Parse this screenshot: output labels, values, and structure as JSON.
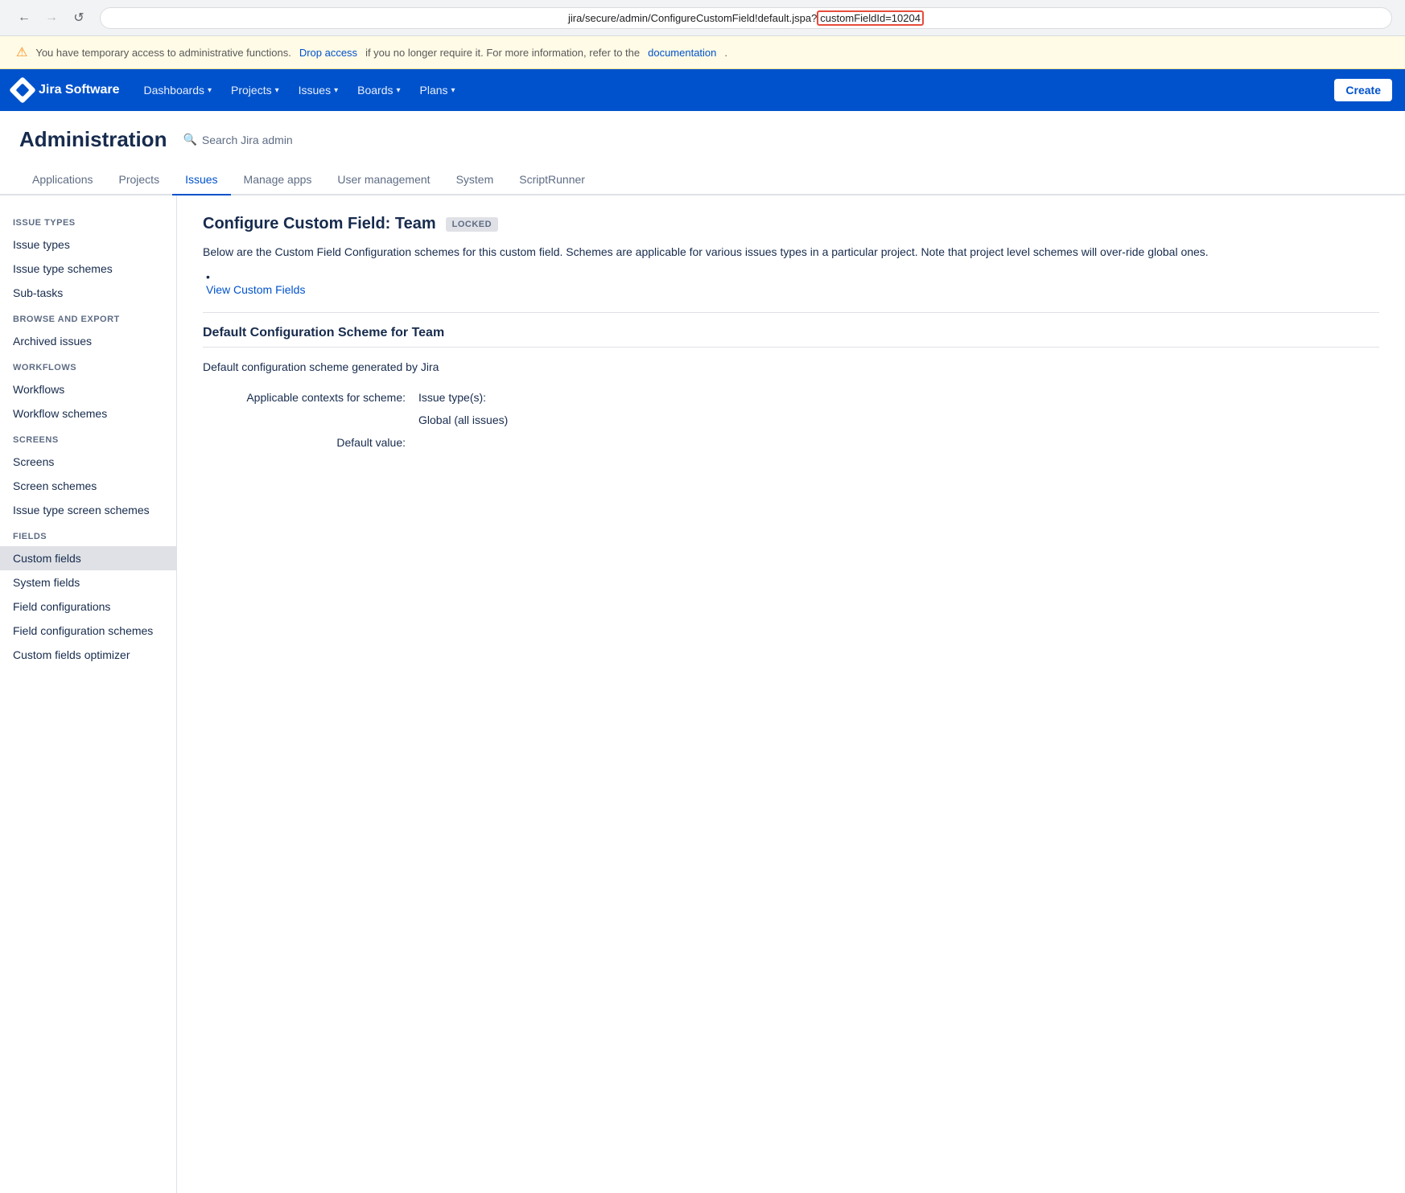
{
  "browser": {
    "back_btn": "←",
    "forward_btn": "→",
    "refresh_btn": "↺",
    "url_prefix": "jira/secure/admin/ConfigureCustomField!default.jspa?",
    "url_highlight": "customFieldId=10204"
  },
  "warning_banner": {
    "icon": "⚠",
    "text_before": "You have temporary access to administrative functions.",
    "drop_access_label": "Drop access",
    "text_middle": " if you no longer require it. For more information, refer to the",
    "documentation_label": "documentation",
    "text_end": "."
  },
  "top_nav": {
    "logo_text": "Jira Software",
    "items": [
      {
        "label": "Dashboards",
        "has_chevron": true
      },
      {
        "label": "Projects",
        "has_chevron": true
      },
      {
        "label": "Issues",
        "has_chevron": true
      },
      {
        "label": "Boards",
        "has_chevron": true
      },
      {
        "label": "Plans",
        "has_chevron": true
      }
    ],
    "create_label": "Create"
  },
  "admin": {
    "title": "Administration",
    "search_placeholder": "Search Jira admin",
    "tabs": [
      {
        "label": "Applications",
        "active": false
      },
      {
        "label": "Projects",
        "active": false
      },
      {
        "label": "Issues",
        "active": true
      },
      {
        "label": "Manage apps",
        "active": false
      },
      {
        "label": "User management",
        "active": false
      },
      {
        "label": "System",
        "active": false
      },
      {
        "label": "ScriptRunner",
        "active": false
      }
    ]
  },
  "sidebar": {
    "sections": [
      {
        "label": "ISSUE TYPES",
        "items": [
          {
            "label": "Issue types",
            "active": false
          },
          {
            "label": "Issue type schemes",
            "active": false
          },
          {
            "label": "Sub-tasks",
            "active": false
          }
        ]
      },
      {
        "label": "BROWSE AND EXPORT",
        "items": [
          {
            "label": "Archived issues",
            "active": false
          }
        ]
      },
      {
        "label": "WORKFLOWS",
        "items": [
          {
            "label": "Workflows",
            "active": false
          },
          {
            "label": "Workflow schemes",
            "active": false
          }
        ]
      },
      {
        "label": "SCREENS",
        "items": [
          {
            "label": "Screens",
            "active": false
          },
          {
            "label": "Screen schemes",
            "active": false
          },
          {
            "label": "Issue type screen schemes",
            "active": false
          }
        ]
      },
      {
        "label": "FIELDS",
        "items": [
          {
            "label": "Custom fields",
            "active": true
          },
          {
            "label": "System fields",
            "active": false
          },
          {
            "label": "Field configurations",
            "active": false
          },
          {
            "label": "Field configuration schemes",
            "active": false
          },
          {
            "label": "Custom fields optimizer",
            "active": false
          }
        ]
      }
    ]
  },
  "content": {
    "page_title": "Configure Custom Field: Team",
    "locked_badge": "LOCKED",
    "description": "Below are the Custom Field Configuration schemes for this custom field. Schemes are applicable for various issues types in a particular project. Note that project level schemes will over-ride global ones.",
    "view_custom_fields_label": "View Custom Fields",
    "scheme": {
      "title": "Default Configuration Scheme for Team",
      "description": "Default configuration scheme generated by Jira",
      "applicable_contexts_label": "Applicable contexts for scheme:",
      "issue_types_label": "Issue type(s):",
      "issue_types_value": "Global (all issues)",
      "default_value_label": "Default value:",
      "default_value": ""
    }
  }
}
